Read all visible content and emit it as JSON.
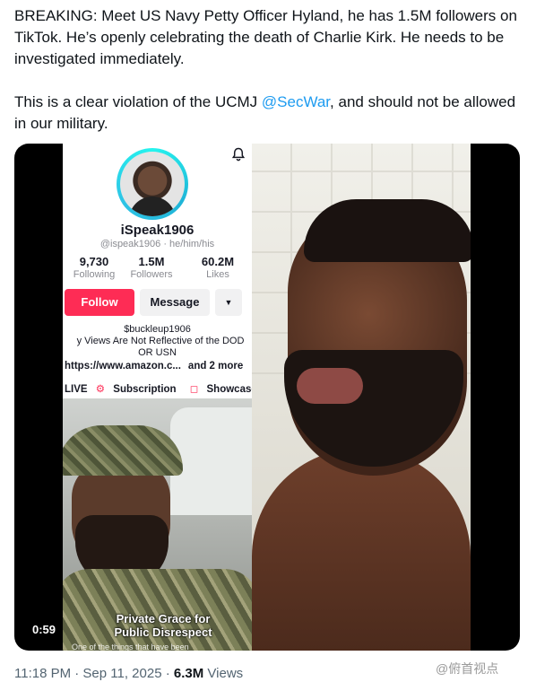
{
  "tweet": {
    "paragraph1": "BREAKING: Meet US Navy Petty Officer Hyland, he has 1.5M followers on TikTok. He’s openly celebrating the death of Charlie Kirk. He needs to be investigated immediately.",
    "paragraph2_before": "This is a clear violation of the UCMJ ",
    "mention": "@SecWar",
    "paragraph2_after": ", and should not be allowed in our military."
  },
  "tiktok": {
    "username": "iSpeak1906",
    "handle": "@ispeak1906 · he/him/his",
    "stats": [
      {
        "value": "9,730",
        "label": "Following"
      },
      {
        "value": "1.5M",
        "label": "Followers"
      },
      {
        "value": "60.2M",
        "label": "Likes"
      }
    ],
    "follow_label": "Follow",
    "message_label": "Message",
    "more_label": "▼",
    "bio_line1": "$buckleup1906",
    "bio_line2": "y Views Are Not Reflective of the DOD",
    "bio_line3": "OR USN",
    "link_text": "https://www.amazon.c...",
    "link_more": "and 2 more",
    "tag_live": "LIVE",
    "tag_subscription": "Subscription",
    "tag_showcase": "Showcase",
    "video_caption": "Private Grace for Public Disrespect",
    "video_subcaption": "One of the things that have been",
    "duration": "0:59"
  },
  "meta": {
    "time": "11:18 PM · Sep 11, 2025 · ",
    "views_count": "6.3M",
    "views_label": " Views"
  },
  "watermark": "@俯首视点"
}
